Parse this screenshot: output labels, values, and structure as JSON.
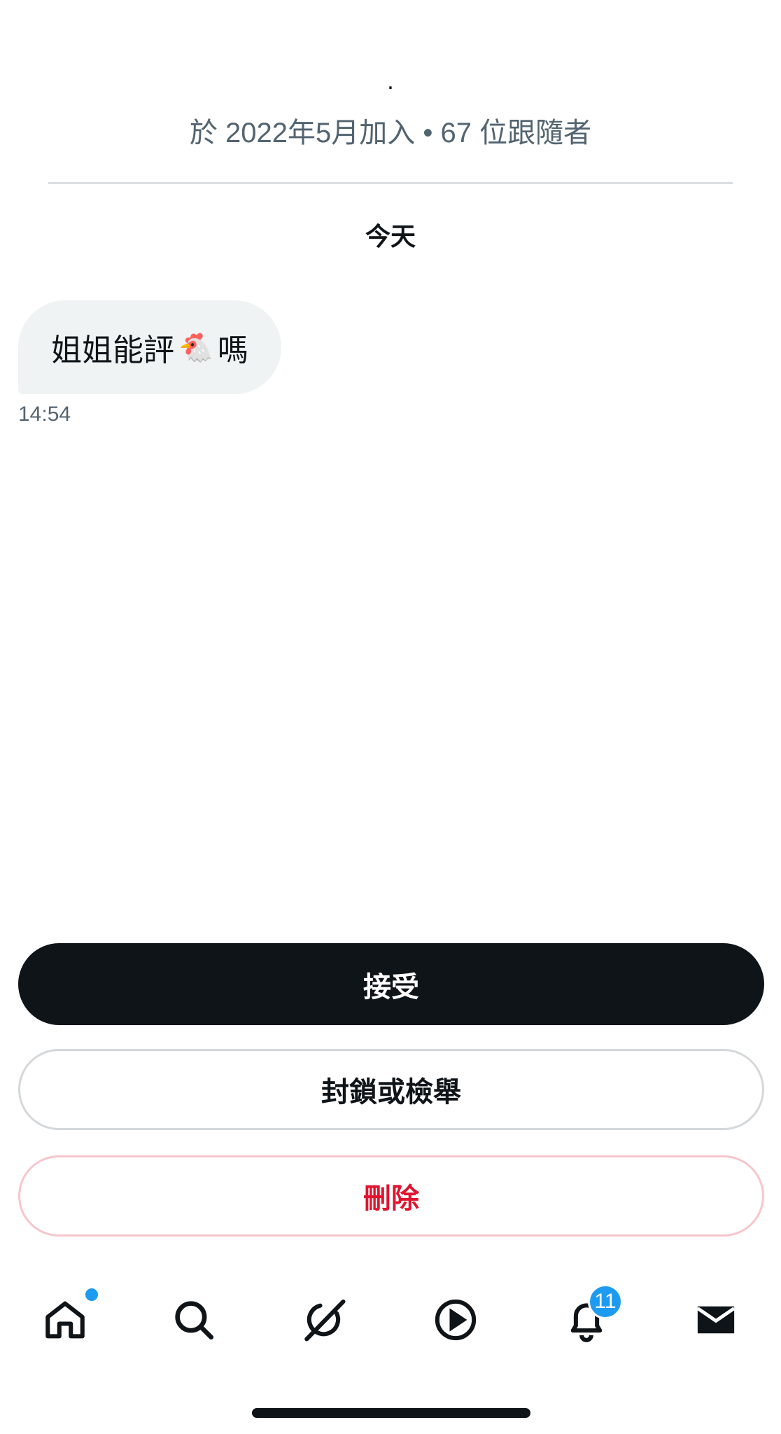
{
  "header": {
    "display_name": ".",
    "profile_meta": "於 2022年5月加入 • 67 位跟隨者"
  },
  "conversation": {
    "date_separator": "今天",
    "messages": [
      {
        "text_before": "姐姐能評",
        "emoji": "🐔",
        "text_after": "嗎",
        "time": "14:54"
      }
    ]
  },
  "actions": {
    "accept_label": "接受",
    "block_report_label": "封鎖或檢舉",
    "delete_label": "刪除"
  },
  "tabbar": {
    "items": [
      {
        "icon": "home-icon",
        "has_dot": true
      },
      {
        "icon": "search-icon"
      },
      {
        "icon": "grok-icon"
      },
      {
        "icon": "video-play-icon"
      },
      {
        "icon": "bell-icon",
        "badge": "11"
      },
      {
        "icon": "mail-icon",
        "active": true
      }
    ]
  },
  "colors": {
    "accent_blue": "#1d9bf0",
    "danger_red": "#e0142f",
    "primary_dark": "#0f1419",
    "muted_gray": "#536471"
  }
}
